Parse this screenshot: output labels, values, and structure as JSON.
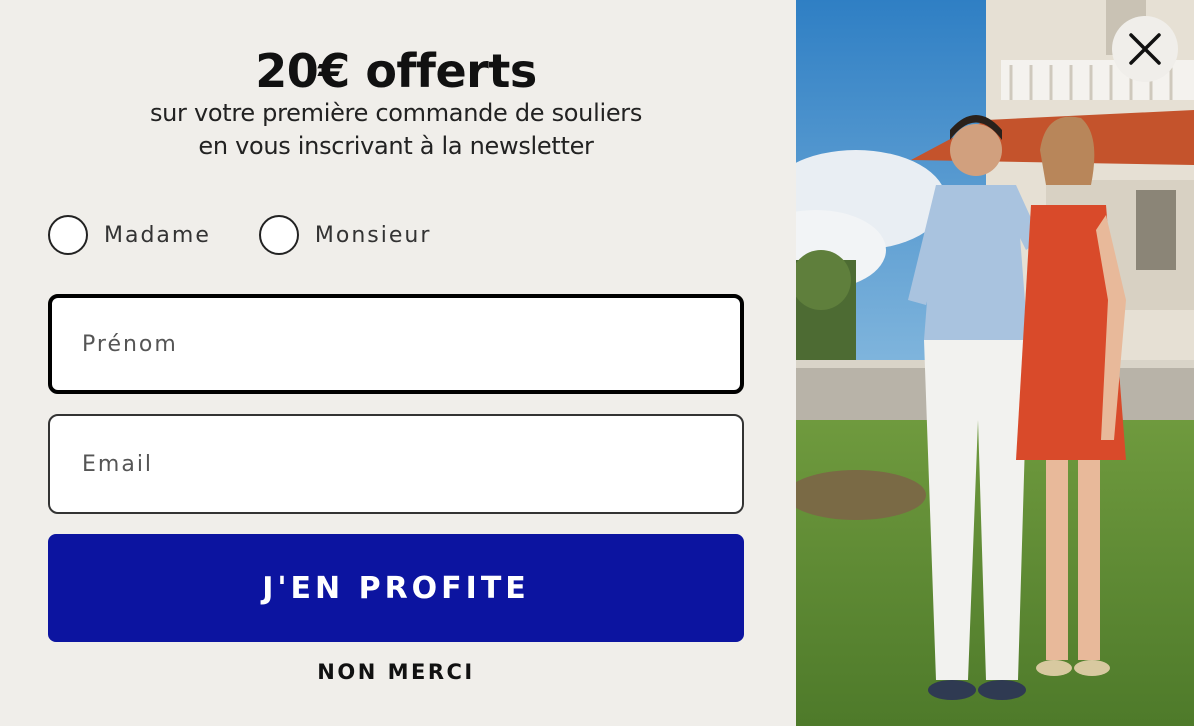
{
  "popup": {
    "headline": "20€ offerts",
    "subline_1": "sur votre première commande de souliers",
    "subline_2": "en vous inscrivant à la newsletter",
    "gender": {
      "options": [
        {
          "label": "Madame",
          "selected": false
        },
        {
          "label": "Monsieur",
          "selected": false
        }
      ]
    },
    "first_name": {
      "placeholder": "Prénom",
      "value": ""
    },
    "email": {
      "placeholder": "Email",
      "value": ""
    },
    "cta_label": "J'EN PROFITE",
    "decline_label": "NON MERCI"
  },
  "colors": {
    "panel_background": "#f0eeea",
    "cta_background": "#0c14a0",
    "cta_text": "#ffffff"
  },
  "icons": {
    "close": "close-icon"
  }
}
